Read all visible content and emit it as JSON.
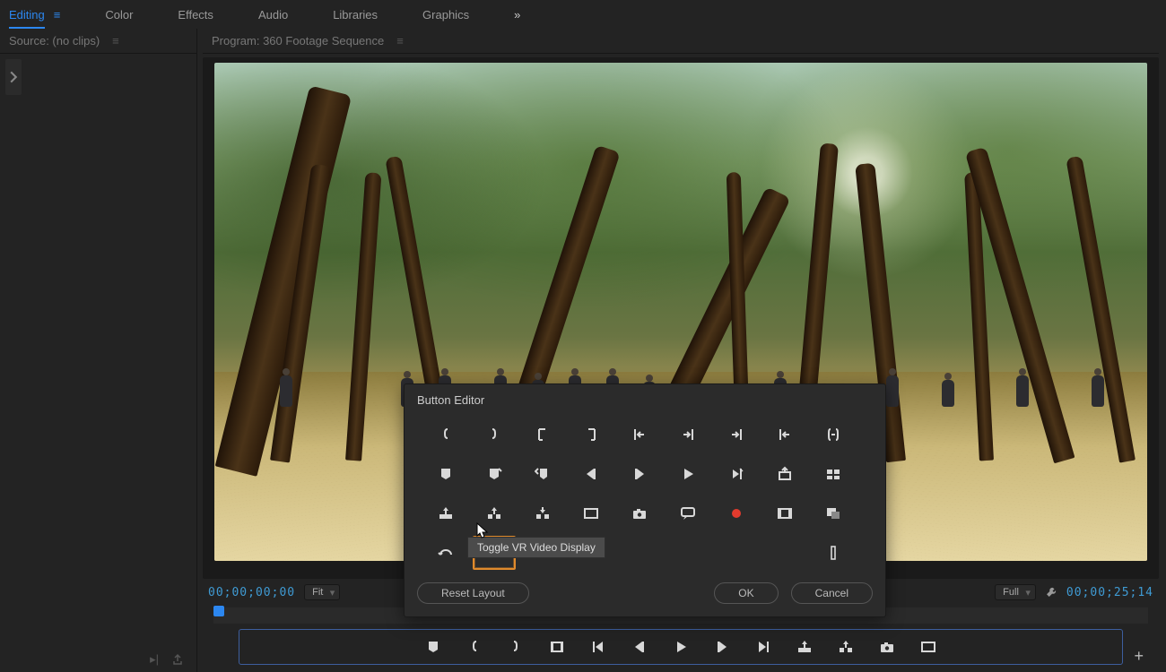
{
  "workspaces": {
    "items": [
      {
        "label": "Editing",
        "active": true
      },
      {
        "label": "Color",
        "active": false
      },
      {
        "label": "Effects",
        "active": false
      },
      {
        "label": "Audio",
        "active": false
      },
      {
        "label": "Libraries",
        "active": false
      },
      {
        "label": "Graphics",
        "active": false
      }
    ],
    "overflow": "»"
  },
  "source_panel": {
    "tab_label": "Source: (no clips)",
    "footer_icons": [
      "step-icon",
      "export-icon"
    ]
  },
  "program_panel": {
    "tab_label": "Program: 360 Footage Sequence",
    "timecode_left": "00;00;00;00",
    "zoom_select": "Fit",
    "res_select": "Full",
    "timecode_right": "00;00;25;14"
  },
  "transport": {
    "buttons": [
      "marker",
      "in-brace",
      "out-brace",
      "in-out",
      "step-back",
      "play",
      "step-fwd",
      "next-edit",
      "lift",
      "extract",
      "camera",
      "safe-margins"
    ]
  },
  "button_editor": {
    "title": "Button Editor",
    "tooltip": "Toggle VR Video Display",
    "footer": {
      "reset": "Reset Layout",
      "ok": "OK",
      "cancel": "Cancel"
    },
    "grid": [
      [
        "in-brace",
        "out-brace",
        "in-goto",
        "out-goto",
        "in-prev",
        "in-next",
        "out-next",
        "out-prev",
        "in-out"
      ],
      [
        "marker",
        "marker-add",
        "marker-prev",
        "frame-back",
        "frame-fwd",
        "play",
        "play-in-out",
        "export-frame",
        "multicam"
      ],
      [
        "lift",
        "extract",
        "insert",
        "safe-margins",
        "camera",
        "comment",
        "record",
        "proxy",
        "overlay"
      ],
      [
        "loop",
        "vr-toggle",
        "fx",
        "crop-pan",
        "",
        "",
        "",
        "",
        "vbar"
      ]
    ]
  },
  "colors": {
    "accent": "#2c87f0",
    "highlight": "#e08a2c",
    "record": "#e33b2e"
  }
}
